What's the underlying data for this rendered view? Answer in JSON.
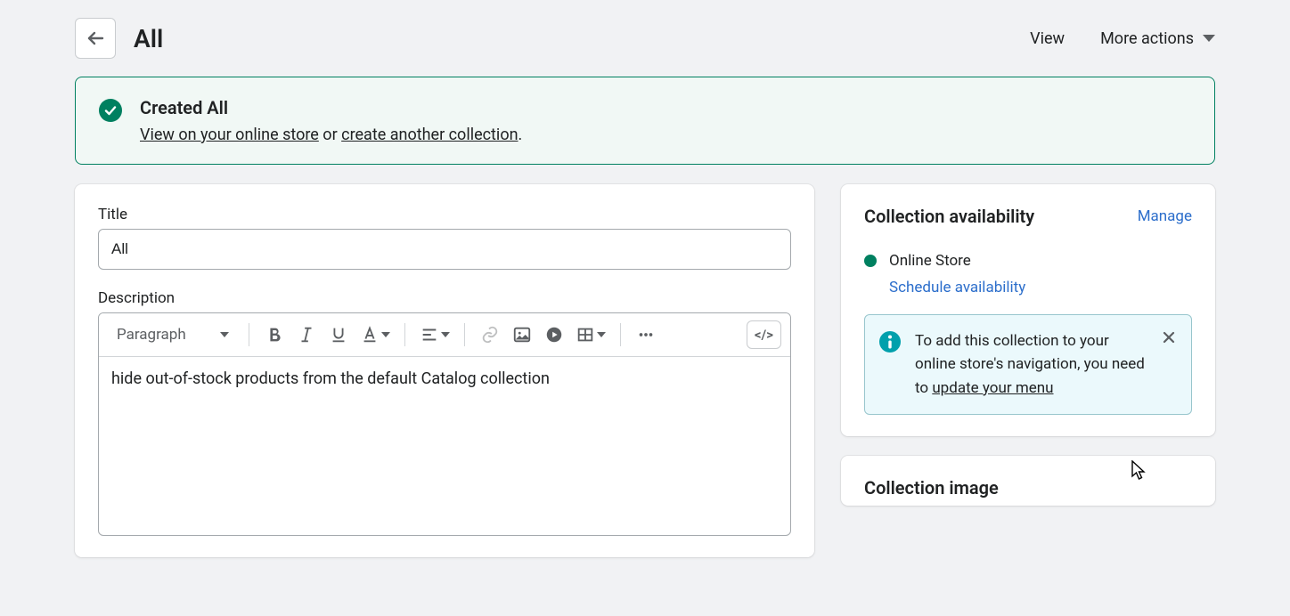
{
  "header": {
    "title": "All",
    "view": "View",
    "more_actions": "More actions"
  },
  "banner": {
    "title": "Created All",
    "link1": "View on your online store",
    "mid": " or ",
    "link2": "create another collection",
    "tail": "."
  },
  "form": {
    "title_label": "Title",
    "title_value": "All",
    "desc_label": "Description",
    "desc_value": "hide out-of-stock products from the default Catalog collection",
    "paragraph_label": "Paragraph"
  },
  "availability": {
    "title": "Collection availability",
    "manage": "Manage",
    "channel": "Online Store",
    "schedule": "Schedule availability",
    "info_text": "To add this collection to your online store's navigation, you need to ",
    "info_link": "update your menu"
  },
  "image_card": {
    "title": "Collection image"
  }
}
